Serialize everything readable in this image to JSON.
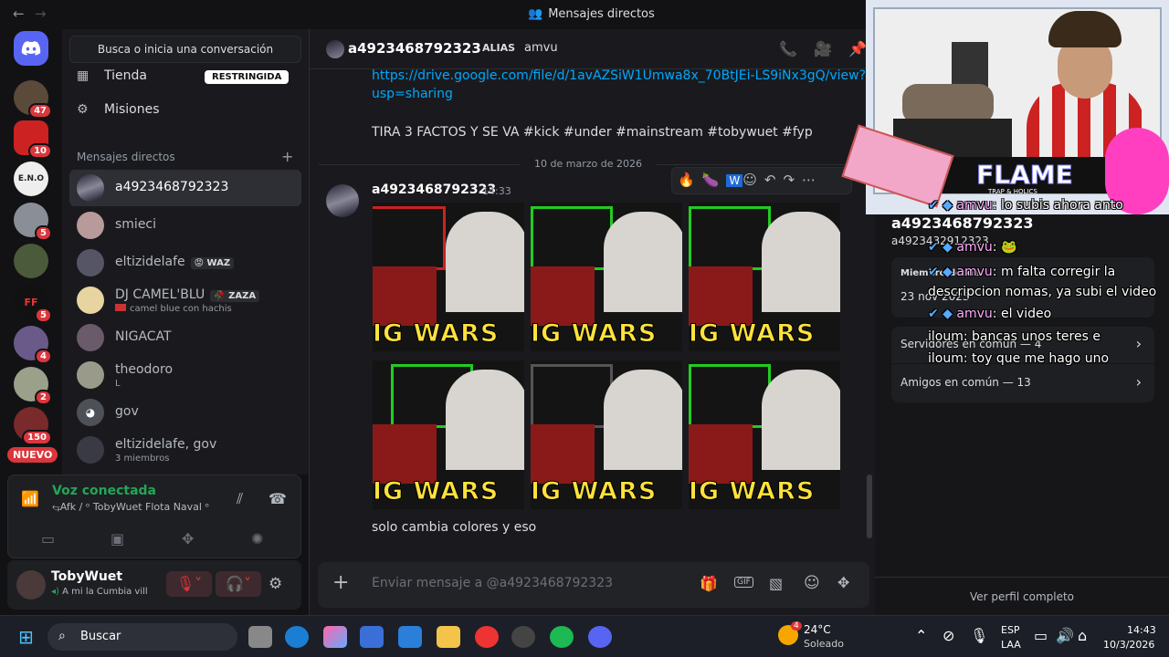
{
  "window": {
    "title": "Mensajes directos"
  },
  "search": {
    "placeholder": "Busca o inicia una conversación"
  },
  "nav": {
    "shop": "Tienda",
    "shop_badge": "RESTRINGIDA",
    "quests": "Misiones"
  },
  "dm_header": "Mensajes directos",
  "dms": [
    {
      "name": "a4923468792323",
      "sub": ""
    },
    {
      "name": "smieci",
      "sub": ""
    },
    {
      "name": "eltizidelafe",
      "tag": "😡 WAZ",
      "sub": ""
    },
    {
      "name": "DJ CAMEL'BLU",
      "tag": "🥀 ZAZA",
      "sub": "camel blue con hachis"
    },
    {
      "name": "NIGACAT",
      "sub": ""
    },
    {
      "name": "theodoro",
      "sub": "L"
    },
    {
      "name": "gov",
      "sub": ""
    },
    {
      "name": "eltizidelafe, gov",
      "sub": "3 miembros"
    }
  ],
  "guild_badges": [
    "47",
    "10",
    "5",
    "5",
    "4",
    "2",
    "150"
  ],
  "new_label": "NUEVO",
  "voice": {
    "status": "Voz conectada",
    "channel": "⥃Afk / ᵒ TobyWuet Flota Naval ᵒ"
  },
  "user": {
    "name": "TobyWuet",
    "status": "A mi la Cumbia vill"
  },
  "chat": {
    "name": "a4923468792323",
    "alias_label": "ALIAS",
    "alias": "amvu",
    "link_line1": "https://drive.google.com/file/d/1avAZSiW1Umwa8x_70BtJEi-LS9iNx3gQ/view?",
    "link_line2": "usp=sharing",
    "caption": "TIRA 3 FACTOS Y SE VA #kick #under #mainstream #tobywuet #fyp",
    "date": "10 de marzo de 2026",
    "author": "a4923468792323",
    "time": "14:33",
    "thumb_text": "IG WARS",
    "message": "solo cambia colores y eso",
    "composer_placeholder": "Enviar mensaje a @a4923468792323"
  },
  "profile": {
    "name": "a4923468792323",
    "handle": "a4923432912323",
    "member_since_label": "Miembro desde",
    "member_since": "23 nov 2023",
    "servers": "Servidores en común — 4",
    "friends": "Amigos en común — 13",
    "view_full": "Ver perfil completo"
  },
  "overlay_chat": [
    {
      "user": "amvu",
      "text": "lo subis ahora anto"
    },
    {
      "user": "amvu",
      "text": ""
    },
    {
      "user": "amvu",
      "text": "m falta corregir la"
    },
    {
      "user": "",
      "text": "descripcion nomas, ya subi el video"
    },
    {
      "user": "amvu",
      "text": "el video"
    },
    {
      "user": "iloum",
      "text": "bancas unos teres e"
    },
    {
      "user": "iloum",
      "text": "toy que me hago uno"
    }
  ],
  "stream": {
    "banner": "FLAME",
    "banner_sub": "TRAP & HOLICS"
  },
  "taskbar": {
    "search": "Buscar",
    "weather_temp": "24°C",
    "weather_desc": "Soleado",
    "weather_badge": "4",
    "lang1": "ESP",
    "lang2": "LAA",
    "time": "14:43",
    "date": "10/3/2026"
  },
  "colors": {
    "accent": "#5865f2",
    "online": "#23a55a",
    "link": "#00a8fc",
    "danger": "#da373c"
  }
}
